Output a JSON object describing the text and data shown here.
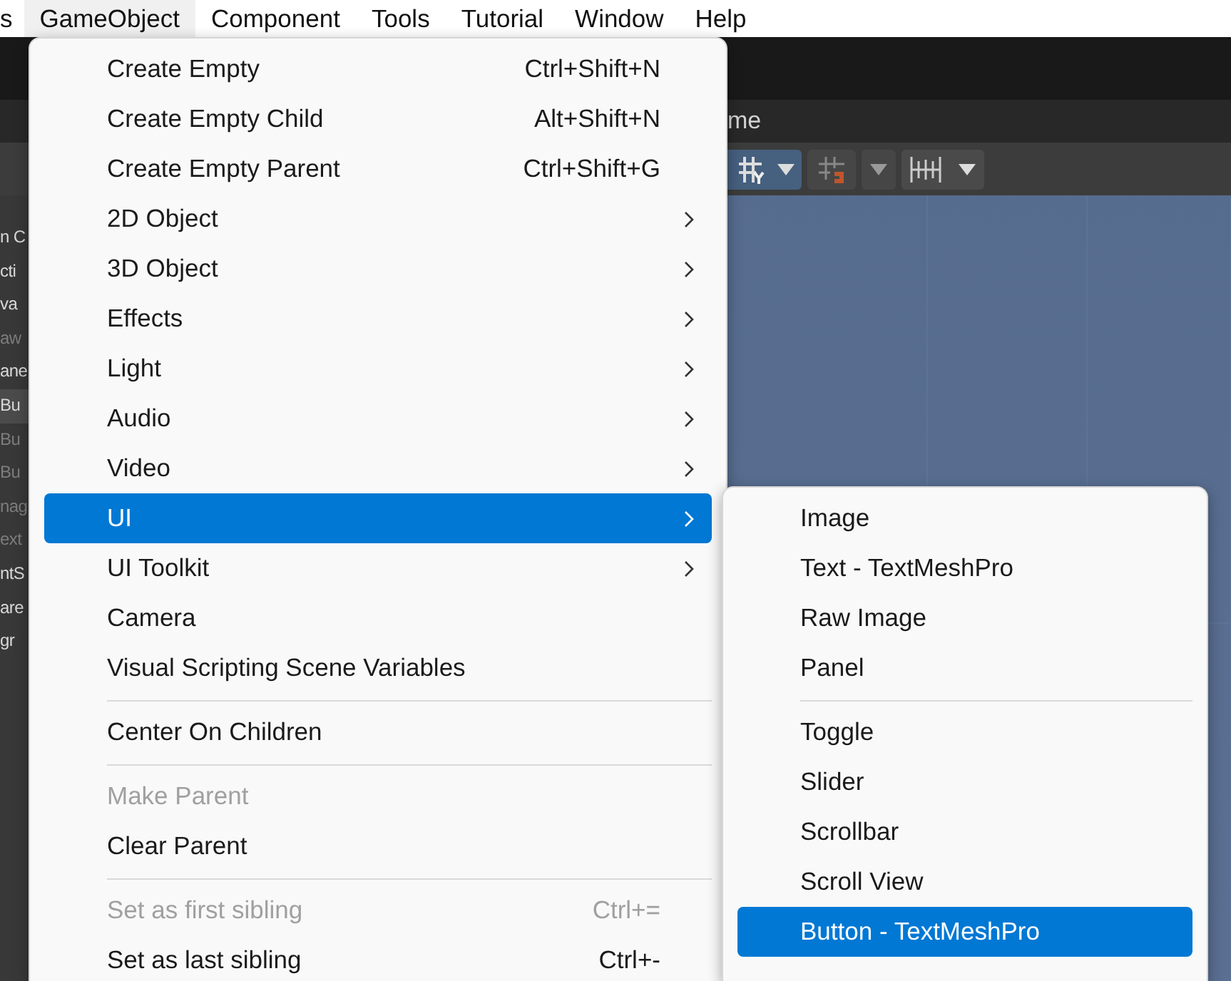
{
  "menubar": [
    {
      "label": "s",
      "selected": false
    },
    {
      "label": "GameObject",
      "selected": true
    },
    {
      "label": "Component",
      "selected": false
    },
    {
      "label": "Tools",
      "selected": false
    },
    {
      "label": "Tutorial",
      "selected": false
    },
    {
      "label": "Window",
      "selected": false
    },
    {
      "label": "Help",
      "selected": false
    }
  ],
  "scene_tab": {
    "label": "me"
  },
  "hierarchy": [
    {
      "text": "n C",
      "dimmed": false,
      "selected": false
    },
    {
      "text": "cti",
      "dimmed": false,
      "selected": false
    },
    {
      "text": "va",
      "dimmed": false,
      "selected": false
    },
    {
      "text": "aw",
      "dimmed": true,
      "selected": false
    },
    {
      "text": "ane",
      "dimmed": false,
      "selected": false
    },
    {
      "text": "Bu",
      "dimmed": false,
      "selected": true
    },
    {
      "text": "Bu",
      "dimmed": true,
      "selected": false
    },
    {
      "text": "Bu",
      "dimmed": true,
      "selected": false
    },
    {
      "text": "nag",
      "dimmed": true,
      "selected": false
    },
    {
      "text": "ext",
      "dimmed": true,
      "selected": false
    },
    {
      "text": "ntS",
      "dimmed": false,
      "selected": false
    },
    {
      "text": "are",
      "dimmed": false,
      "selected": false
    },
    {
      "text": "gr",
      "dimmed": false,
      "selected": false
    }
  ],
  "gameobject_menu": [
    {
      "kind": "item",
      "label": "Create Empty",
      "shortcut": "Ctrl+Shift+N",
      "submenu": false,
      "disabled": false,
      "selected": false
    },
    {
      "kind": "item",
      "label": "Create Empty Child",
      "shortcut": "Alt+Shift+N",
      "submenu": false,
      "disabled": false,
      "selected": false
    },
    {
      "kind": "item",
      "label": "Create Empty Parent",
      "shortcut": "Ctrl+Shift+G",
      "submenu": false,
      "disabled": false,
      "selected": false
    },
    {
      "kind": "item",
      "label": "2D Object",
      "submenu": true,
      "disabled": false,
      "selected": false
    },
    {
      "kind": "item",
      "label": "3D Object",
      "submenu": true,
      "disabled": false,
      "selected": false
    },
    {
      "kind": "item",
      "label": "Effects",
      "submenu": true,
      "disabled": false,
      "selected": false
    },
    {
      "kind": "item",
      "label": "Light",
      "submenu": true,
      "disabled": false,
      "selected": false
    },
    {
      "kind": "item",
      "label": "Audio",
      "submenu": true,
      "disabled": false,
      "selected": false
    },
    {
      "kind": "item",
      "label": "Video",
      "submenu": true,
      "disabled": false,
      "selected": false
    },
    {
      "kind": "item",
      "label": "UI",
      "submenu": true,
      "disabled": false,
      "selected": true
    },
    {
      "kind": "item",
      "label": "UI Toolkit",
      "submenu": true,
      "disabled": false,
      "selected": false
    },
    {
      "kind": "item",
      "label": "Camera",
      "submenu": false,
      "disabled": false,
      "selected": false
    },
    {
      "kind": "item",
      "label": "Visual Scripting Scene Variables",
      "submenu": false,
      "disabled": false,
      "selected": false
    },
    {
      "kind": "separator"
    },
    {
      "kind": "item",
      "label": "Center On Children",
      "submenu": false,
      "disabled": false,
      "selected": false
    },
    {
      "kind": "separator"
    },
    {
      "kind": "item",
      "label": "Make Parent",
      "submenu": false,
      "disabled": true,
      "selected": false
    },
    {
      "kind": "item",
      "label": "Clear Parent",
      "submenu": false,
      "disabled": false,
      "selected": false
    },
    {
      "kind": "separator"
    },
    {
      "kind": "item",
      "label": "Set as first sibling",
      "shortcut": "Ctrl+=",
      "submenu": false,
      "disabled": true,
      "selected": false
    },
    {
      "kind": "item",
      "label": "Set as last sibling",
      "shortcut": "Ctrl+-",
      "submenu": false,
      "disabled": false,
      "selected": false
    }
  ],
  "ui_submenu": [
    {
      "kind": "item",
      "label": "Image",
      "submenu": false,
      "disabled": false,
      "selected": false
    },
    {
      "kind": "item",
      "label": "Text - TextMeshPro",
      "submenu": false,
      "disabled": false,
      "selected": false
    },
    {
      "kind": "item",
      "label": "Raw Image",
      "submenu": false,
      "disabled": false,
      "selected": false
    },
    {
      "kind": "item",
      "label": "Panel",
      "submenu": false,
      "disabled": false,
      "selected": false
    },
    {
      "kind": "separator"
    },
    {
      "kind": "item",
      "label": "Toggle",
      "submenu": false,
      "disabled": false,
      "selected": false
    },
    {
      "kind": "item",
      "label": "Slider",
      "submenu": false,
      "disabled": false,
      "selected": false
    },
    {
      "kind": "item",
      "label": "Scrollbar",
      "submenu": false,
      "disabled": false,
      "selected": false
    },
    {
      "kind": "item",
      "label": "Scroll View",
      "submenu": false,
      "disabled": false,
      "selected": false
    },
    {
      "kind": "item",
      "label": "Button - TextMeshPro",
      "submenu": false,
      "disabled": false,
      "selected": true
    }
  ]
}
